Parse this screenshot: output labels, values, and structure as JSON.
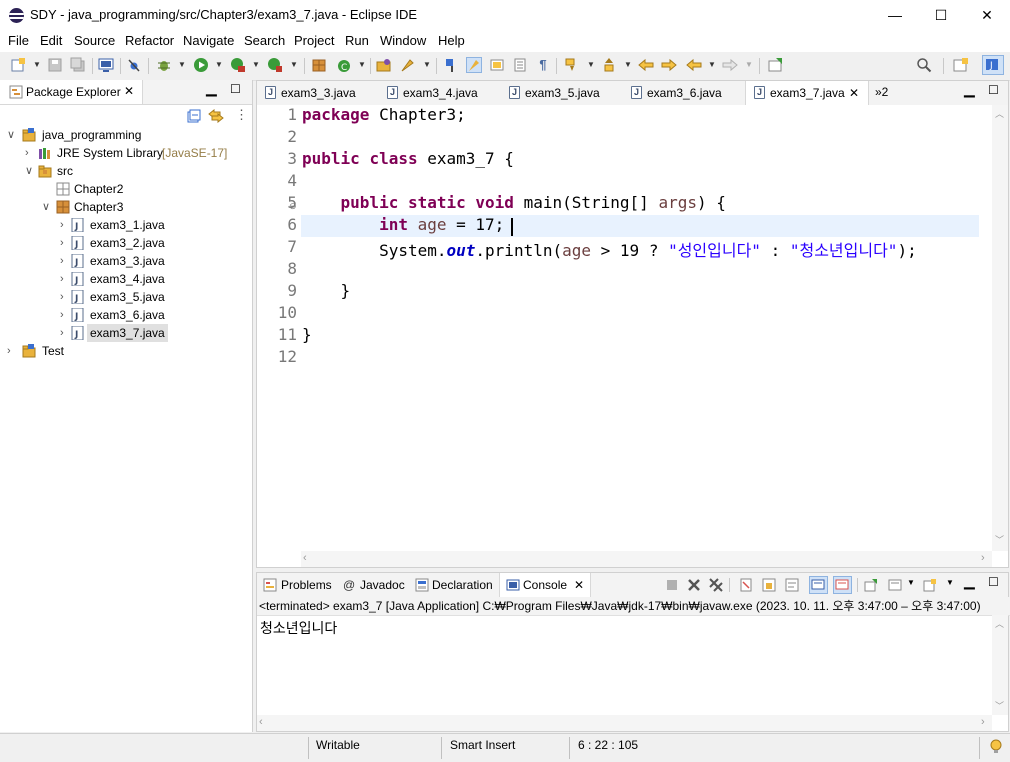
{
  "window": {
    "title": "SDY - java_programming/src/Chapter3/exam3_7.java - Eclipse IDE",
    "min_symbol": "—",
    "max_symbol": "☐",
    "close_symbol": "✕"
  },
  "menu": [
    "File",
    "Edit",
    "Source",
    "Refactor",
    "Navigate",
    "Search",
    "Project",
    "Run",
    "Window",
    "Help"
  ],
  "package_explorer": {
    "tab_label": "Package Explorer",
    "tree": {
      "project": "java_programming",
      "jre": "JRE System Library",
      "jre_version": "[JavaSE-17]",
      "src": "src",
      "pkg1": "Chapter2",
      "pkg2": "Chapter3",
      "files": [
        "exam3_1.java",
        "exam3_2.java",
        "exam3_3.java",
        "exam3_4.java",
        "exam3_5.java",
        "exam3_6.java",
        "exam3_7.java"
      ],
      "project2": "Test"
    }
  },
  "editor": {
    "tabs": [
      "exam3_3.java",
      "exam3_4.java",
      "exam3_5.java",
      "exam3_6.java",
      "exam3_7.java"
    ],
    "overflow": "»2",
    "line_numbers": [
      "1",
      "2",
      "3",
      "4",
      "5",
      "6",
      "7",
      "8",
      "9",
      "10",
      "11",
      "12"
    ],
    "code": {
      "l1_kw": "package",
      "l1_rest": " Chapter3;",
      "l3_kw1": "public",
      "l3_kw2": "class",
      "l3_rest": " exam3_7 {",
      "l5_kw1": "public",
      "l5_kw2": "static",
      "l5_kw3": "void",
      "l5_rest1": " main(String[] ",
      "l5_param": "args",
      "l5_rest2": ") {",
      "l6_kw": "int",
      "l6_var": "age",
      "l6_rest": " = 17;",
      "l7_a": "System.",
      "l7_out": "out",
      "l7_b": ".println(",
      "l7_var": "age",
      "l7_c": " > 19 ? ",
      "l7_s1": "\"성인입니다\"",
      "l7_d": " : ",
      "l7_s2": "\"청소년입니다\"",
      "l7_e": ");",
      "l9": "}",
      "l11": "}"
    }
  },
  "console": {
    "tabs": [
      "Problems",
      "Javadoc",
      "Declaration",
      "Console"
    ],
    "javadoc_at": "@",
    "status_line": "<terminated> exam3_7 [Java Application] C:₩Program Files₩Java₩jdk-17₩bin₩javaw.exe  (2023. 10. 11. 오후 3:47:00 – 오후 3:47:00)",
    "output": "청소년입니다"
  },
  "statusbar": {
    "writable": "Writable",
    "insert_mode": "Smart Insert",
    "position": "6 : 22 : 105"
  },
  "colors": {
    "keyword": "#7f0055",
    "string": "#2a00ff",
    "field": "#0000c0",
    "local_var": "#6a3e3e",
    "current_line": "#e8f2fe"
  }
}
